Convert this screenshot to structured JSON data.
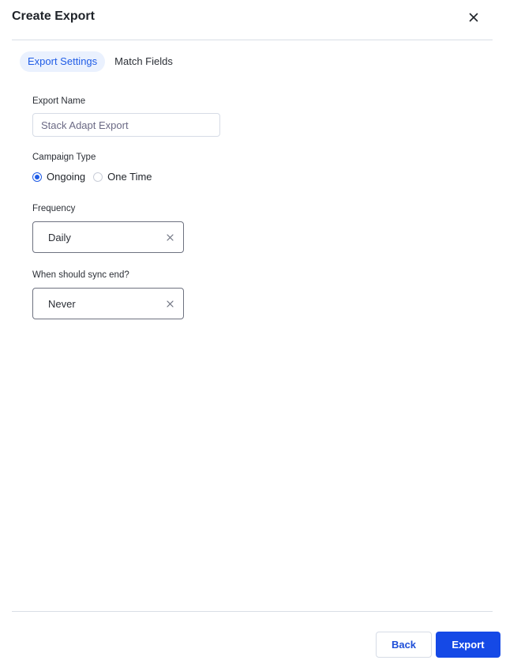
{
  "dialog": {
    "title": "Create Export",
    "close_icon": "close-icon"
  },
  "tabs": [
    {
      "label": "Export Settings",
      "active": true
    },
    {
      "label": "Match Fields",
      "active": false
    }
  ],
  "form": {
    "export_name": {
      "label": "Export Name",
      "value": "",
      "placeholder": "Stack Adapt Export"
    },
    "campaign_type": {
      "label": "Campaign Type",
      "options": [
        {
          "label": "Ongoing",
          "checked": true
        },
        {
          "label": "One Time",
          "checked": false
        }
      ]
    },
    "frequency": {
      "label": "Frequency",
      "value": "Daily",
      "clear_icon": "clear-icon"
    },
    "sync_end": {
      "label": "When should sync end?",
      "value": "Never",
      "clear_icon": "clear-icon"
    }
  },
  "footer": {
    "back_label": "Back",
    "export_label": "Export"
  },
  "colors": {
    "accent": "#1549e6",
    "tab_active_bg": "#eaf1fe"
  }
}
